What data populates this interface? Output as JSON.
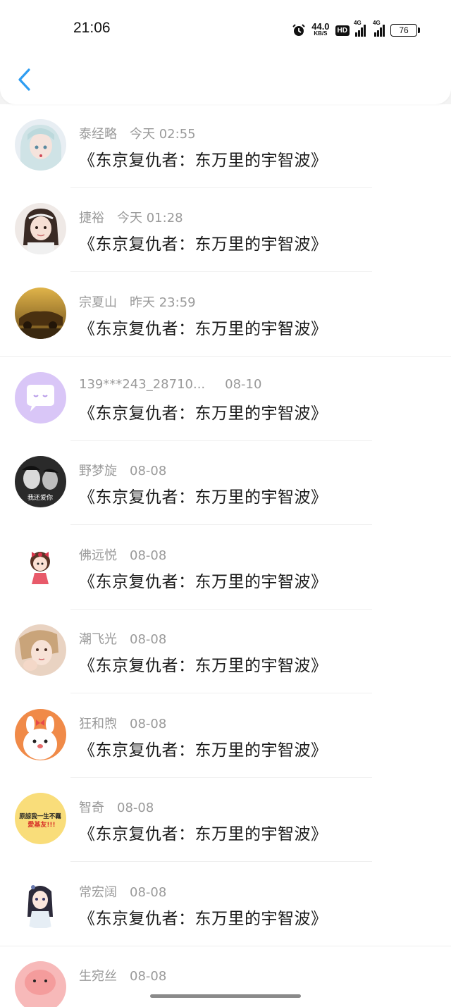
{
  "status": {
    "time": "21:06",
    "net_speed": "44.0",
    "net_unit": "KB/S",
    "hd": "HD",
    "sim1": "4G",
    "sim2": "4G",
    "battery": "76"
  },
  "messages": [
    {
      "name": "泰经略",
      "time": "今天 02:55",
      "title": "《东京复仇者：东万里的宇智波》",
      "avatar": "anime-girl-silver-hair"
    },
    {
      "name": "捷裕",
      "time": "今天 01:28",
      "title": "《东京复仇者：东万里的宇智波》",
      "avatar": "girl-photo"
    },
    {
      "name": "宗夏山",
      "time": "昨天 23:59",
      "title": "《东京复仇者：东万里的宇智波》",
      "avatar": "golden-car"
    },
    {
      "name": "139***243_28710...",
      "time": "08-10",
      "title": "《东京复仇者：东万里的宇智波》",
      "avatar": "default-chat-bubble"
    },
    {
      "name": "野梦旋",
      "time": "08-08",
      "title": "《东京复仇者：东万里的宇智波》",
      "avatar": "couple-bw",
      "avatar_text": "我还爱你"
    },
    {
      "name": "佛远悦",
      "time": "08-08",
      "title": "《东京复仇者：东万里的宇智波》",
      "avatar": "cartoon-girl-bow"
    },
    {
      "name": "潮飞光",
      "time": "08-08",
      "title": "《东京复仇者：东万里的宇智波》",
      "avatar": "woman-selfie"
    },
    {
      "name": "狂和煦",
      "time": "08-08",
      "title": "《东京复仇者：东万里的宇智波》",
      "avatar": "cartoon-bunny"
    },
    {
      "name": "智奇",
      "time": "08-08",
      "title": "《东京复仇者：东万里的宇智波》",
      "avatar": "text-badge",
      "avatar_text_1": "原諒我一生不羈",
      "avatar_text_2": "愛基友!!!"
    },
    {
      "name": "常宏阔",
      "time": "08-08",
      "title": "《东京复仇者：东万里的宇智波》",
      "avatar": "anime-girl-dark-hair"
    },
    {
      "name": "生宛丝",
      "time": "08-08",
      "title": "",
      "avatar": "pink-cartoon"
    }
  ]
}
